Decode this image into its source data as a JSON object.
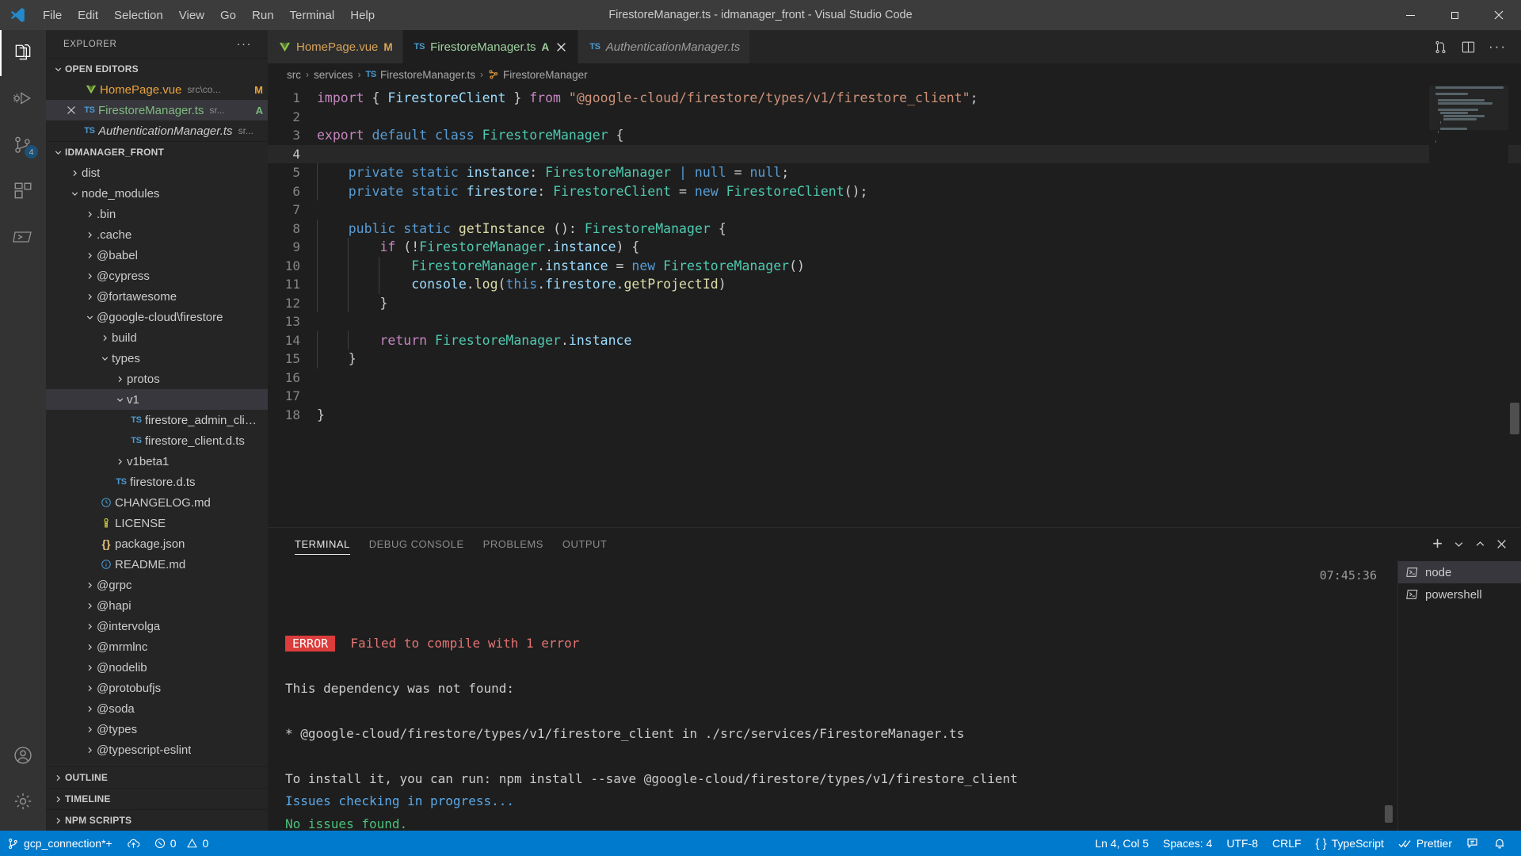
{
  "titlebar": {
    "title": "FirestoreManager.ts - idmanager_front - Visual Studio Code",
    "menus": [
      "File",
      "Edit",
      "Selection",
      "View",
      "Go",
      "Run",
      "Terminal",
      "Help"
    ],
    "minimize_label": "Minimize",
    "maximize_label": "Restore",
    "close_label": "Close"
  },
  "activitybar": {
    "items": [
      {
        "name": "explorer",
        "icon": "files-icon",
        "badge": ""
      },
      {
        "name": "run-and-debug",
        "icon": "debug-icon",
        "badge": ""
      },
      {
        "name": "source-control",
        "icon": "source-control-icon",
        "badge": "4"
      },
      {
        "name": "extensions",
        "icon": "extensions-icon",
        "badge": ""
      },
      {
        "name": "remote-explorer",
        "icon": "remote-icon",
        "badge": ""
      }
    ],
    "bottom": [
      {
        "name": "accounts",
        "icon": "account-icon"
      },
      {
        "name": "manage",
        "icon": "gear-icon"
      }
    ]
  },
  "sidebar": {
    "header": "EXPLORER",
    "more_actions": "···",
    "open_editors": {
      "title": "OPEN EDITORS",
      "items": [
        {
          "name": "HomePage.vue",
          "path": "src\\co...",
          "badge": "M",
          "icon": "vue-icon",
          "selected": false,
          "italic": false,
          "close": false
        },
        {
          "name": "FirestoreManager.ts",
          "path": "sr...",
          "badge": "A",
          "icon": "ts-icon",
          "selected": true,
          "italic": false,
          "close": true
        },
        {
          "name": "AuthenticationManager.ts",
          "path": "sr...",
          "badge": "",
          "icon": "ts-icon",
          "selected": false,
          "italic": true,
          "close": false
        }
      ]
    },
    "project": {
      "title": "IDMANAGER_FRONT",
      "tree": [
        {
          "label": "dist",
          "depth": 1,
          "kind": "folder",
          "state": "collapsed"
        },
        {
          "label": "node_modules",
          "depth": 1,
          "kind": "folder",
          "state": "expanded"
        },
        {
          "label": ".bin",
          "depth": 2,
          "kind": "folder",
          "state": "collapsed"
        },
        {
          "label": ".cache",
          "depth": 2,
          "kind": "folder",
          "state": "collapsed"
        },
        {
          "label": "@babel",
          "depth": 2,
          "kind": "folder",
          "state": "collapsed"
        },
        {
          "label": "@cypress",
          "depth": 2,
          "kind": "folder",
          "state": "collapsed"
        },
        {
          "label": "@fortawesome",
          "depth": 2,
          "kind": "folder",
          "state": "collapsed"
        },
        {
          "label": "@google-cloud\\firestore",
          "depth": 2,
          "kind": "folder",
          "state": "expanded"
        },
        {
          "label": "build",
          "depth": 3,
          "kind": "folder",
          "state": "collapsed"
        },
        {
          "label": "types",
          "depth": 3,
          "kind": "folder",
          "state": "expanded"
        },
        {
          "label": "protos",
          "depth": 4,
          "kind": "folder",
          "state": "collapsed"
        },
        {
          "label": "v1",
          "depth": 4,
          "kind": "folder",
          "state": "expanded",
          "selected": true
        },
        {
          "label": "firestore_admin_client.d.ts",
          "depth": 5,
          "kind": "file",
          "icon": "ts-icon"
        },
        {
          "label": "firestore_client.d.ts",
          "depth": 5,
          "kind": "file",
          "icon": "ts-icon"
        },
        {
          "label": "v1beta1",
          "depth": 4,
          "kind": "folder",
          "state": "collapsed"
        },
        {
          "label": "firestore.d.ts",
          "depth": 4,
          "kind": "file",
          "icon": "ts-icon"
        },
        {
          "label": "CHANGELOG.md",
          "depth": 3,
          "kind": "file",
          "icon": "changelog-icon"
        },
        {
          "label": "LICENSE",
          "depth": 3,
          "kind": "file",
          "icon": "license-icon"
        },
        {
          "label": "package.json",
          "depth": 3,
          "kind": "file",
          "icon": "json-icon"
        },
        {
          "label": "README.md",
          "depth": 3,
          "kind": "file",
          "icon": "readme-icon"
        },
        {
          "label": "@grpc",
          "depth": 2,
          "kind": "folder",
          "state": "collapsed"
        },
        {
          "label": "@hapi",
          "depth": 2,
          "kind": "folder",
          "state": "collapsed"
        },
        {
          "label": "@intervolga",
          "depth": 2,
          "kind": "folder",
          "state": "collapsed"
        },
        {
          "label": "@mrmlnc",
          "depth": 2,
          "kind": "folder",
          "state": "collapsed"
        },
        {
          "label": "@nodelib",
          "depth": 2,
          "kind": "folder",
          "state": "collapsed"
        },
        {
          "label": "@protobufjs",
          "depth": 2,
          "kind": "folder",
          "state": "collapsed"
        },
        {
          "label": "@soda",
          "depth": 2,
          "kind": "folder",
          "state": "collapsed"
        },
        {
          "label": "@types",
          "depth": 2,
          "kind": "folder",
          "state": "collapsed"
        },
        {
          "label": "@typescript-eslint",
          "depth": 2,
          "kind": "folder",
          "state": "collapsed"
        }
      ]
    },
    "bottom_sections": [
      "OUTLINE",
      "TIMELINE",
      "NPM SCRIPTS"
    ]
  },
  "editor": {
    "tabs": [
      {
        "label": "HomePage.vue",
        "icon": "vue-icon",
        "badge": "M",
        "active": false,
        "italic": false,
        "closable": false
      },
      {
        "label": "FirestoreManager.ts",
        "icon": "ts-icon",
        "badge": "A",
        "active": true,
        "italic": false,
        "closable": true
      },
      {
        "label": "AuthenticationManager.ts",
        "icon": "ts-icon",
        "badge": "",
        "active": false,
        "italic": true,
        "closable": false
      }
    ],
    "actions": [
      {
        "name": "split-diff-icon"
      },
      {
        "name": "split-editor-icon"
      },
      {
        "name": "more-actions-icon"
      }
    ],
    "breadcrumbs": [
      "src",
      "services",
      "FirestoreManager.ts",
      "FirestoreManager"
    ],
    "current_line": 4,
    "lines": [
      {
        "n": 1,
        "segs": [
          {
            "t": "import ",
            "c": "kw"
          },
          {
            "t": "{ ",
            "c": "pl"
          },
          {
            "t": "FirestoreClient",
            "c": "var"
          },
          {
            "t": " } ",
            "c": "pl"
          },
          {
            "t": "from ",
            "c": "kw"
          },
          {
            "t": "\"@google-cloud/firestore/types/v1/firestore_client\"",
            "c": "str"
          },
          {
            "t": ";",
            "c": "pl"
          }
        ]
      },
      {
        "n": 2,
        "segs": []
      },
      {
        "n": 3,
        "segs": [
          {
            "t": "export ",
            "c": "kw"
          },
          {
            "t": "default ",
            "c": "kw2"
          },
          {
            "t": "class ",
            "c": "kw2"
          },
          {
            "t": "FirestoreManager",
            "c": "typ"
          },
          {
            "t": " {",
            "c": "pl"
          }
        ]
      },
      {
        "n": 4,
        "segs": []
      },
      {
        "n": 5,
        "segs": [
          {
            "t": "    ",
            "c": "pl"
          },
          {
            "t": "private ",
            "c": "kw2"
          },
          {
            "t": "static ",
            "c": "kw2"
          },
          {
            "t": "instance",
            "c": "var"
          },
          {
            "t": ": ",
            "c": "pl"
          },
          {
            "t": "FirestoreManager",
            "c": "typ"
          },
          {
            "t": " | ",
            "c": "kw2"
          },
          {
            "t": "null",
            "c": "kw2"
          },
          {
            "t": " = ",
            "c": "pl"
          },
          {
            "t": "null",
            "c": "kw2"
          },
          {
            "t": ";",
            "c": "pl"
          }
        ]
      },
      {
        "n": 6,
        "segs": [
          {
            "t": "    ",
            "c": "pl"
          },
          {
            "t": "private ",
            "c": "kw2"
          },
          {
            "t": "static ",
            "c": "kw2"
          },
          {
            "t": "firestore",
            "c": "var"
          },
          {
            "t": ": ",
            "c": "pl"
          },
          {
            "t": "FirestoreClient",
            "c": "typ"
          },
          {
            "t": " = ",
            "c": "pl"
          },
          {
            "t": "new ",
            "c": "kw2"
          },
          {
            "t": "FirestoreClient",
            "c": "typ"
          },
          {
            "t": "();",
            "c": "pl"
          }
        ]
      },
      {
        "n": 7,
        "segs": []
      },
      {
        "n": 8,
        "segs": [
          {
            "t": "    ",
            "c": "pl"
          },
          {
            "t": "public ",
            "c": "kw2"
          },
          {
            "t": "static ",
            "c": "kw2"
          },
          {
            "t": "getInstance ",
            "c": "fn"
          },
          {
            "t": "(): ",
            "c": "pl"
          },
          {
            "t": "FirestoreManager",
            "c": "typ"
          },
          {
            "t": " {",
            "c": "pl"
          }
        ]
      },
      {
        "n": 9,
        "segs": [
          {
            "t": "        ",
            "c": "pl"
          },
          {
            "t": "if ",
            "c": "ctrl"
          },
          {
            "t": "(!",
            "c": "pl"
          },
          {
            "t": "FirestoreManager",
            "c": "typ"
          },
          {
            "t": ".",
            "c": "pl"
          },
          {
            "t": "instance",
            "c": "var"
          },
          {
            "t": ") {",
            "c": "pl"
          }
        ]
      },
      {
        "n": 10,
        "segs": [
          {
            "t": "            ",
            "c": "pl"
          },
          {
            "t": "FirestoreManager",
            "c": "typ"
          },
          {
            "t": ".",
            "c": "pl"
          },
          {
            "t": "instance",
            "c": "var"
          },
          {
            "t": " = ",
            "c": "pl"
          },
          {
            "t": "new ",
            "c": "kw2"
          },
          {
            "t": "FirestoreManager",
            "c": "typ"
          },
          {
            "t": "()",
            "c": "pl"
          }
        ]
      },
      {
        "n": 11,
        "segs": [
          {
            "t": "            ",
            "c": "pl"
          },
          {
            "t": "console",
            "c": "var"
          },
          {
            "t": ".",
            "c": "pl"
          },
          {
            "t": "log",
            "c": "fn"
          },
          {
            "t": "(",
            "c": "pl"
          },
          {
            "t": "this",
            "c": "kw2"
          },
          {
            "t": ".",
            "c": "pl"
          },
          {
            "t": "firestore",
            "c": "var"
          },
          {
            "t": ".",
            "c": "pl"
          },
          {
            "t": "getProjectId",
            "c": "fn"
          },
          {
            "t": ")",
            "c": "pl"
          }
        ]
      },
      {
        "n": 12,
        "segs": [
          {
            "t": "        }",
            "c": "pl"
          }
        ]
      },
      {
        "n": 13,
        "segs": []
      },
      {
        "n": 14,
        "segs": [
          {
            "t": "        ",
            "c": "pl"
          },
          {
            "t": "return ",
            "c": "kw"
          },
          {
            "t": "FirestoreManager",
            "c": "typ"
          },
          {
            "t": ".",
            "c": "pl"
          },
          {
            "t": "instance",
            "c": "var"
          }
        ]
      },
      {
        "n": 15,
        "segs": [
          {
            "t": "    }",
            "c": "pl"
          }
        ]
      },
      {
        "n": 16,
        "segs": []
      },
      {
        "n": 17,
        "segs": []
      },
      {
        "n": 18,
        "segs": [
          {
            "t": "}",
            "c": "pl"
          }
        ]
      }
    ]
  },
  "panel": {
    "tabs": [
      "TERMINAL",
      "DEBUG CONSOLE",
      "PROBLEMS",
      "OUTPUT"
    ],
    "active_tab": "TERMINAL",
    "actions": [
      {
        "name": "new-terminal-icon",
        "glyph": "+"
      },
      {
        "name": "terminal-dropdown-icon",
        "glyph": "˅"
      },
      {
        "name": "maximize-panel-icon",
        "glyph": "˄"
      },
      {
        "name": "close-panel-icon",
        "glyph": "✕"
      }
    ],
    "timestamp": "07:45:36",
    "terminal_lines": [
      {
        "type": "error_badge",
        "badge": "ERROR",
        "text": "Failed to compile with 1 error"
      },
      {
        "type": "blank",
        "text": ""
      },
      {
        "type": "plain",
        "text": "This dependency was not found:"
      },
      {
        "type": "blank",
        "text": ""
      },
      {
        "type": "plain",
        "text": "* @google-cloud/firestore/types/v1/firestore_client in ./src/services/FirestoreManager.ts"
      },
      {
        "type": "blank",
        "text": ""
      },
      {
        "type": "plain",
        "text": "To install it, you can run: npm install --save @google-cloud/firestore/types/v1/firestore_client"
      },
      {
        "type": "info",
        "text": "Issues checking in progress..."
      },
      {
        "type": "success",
        "text": "No issues found."
      },
      {
        "type": "cursor",
        "text": ""
      }
    ],
    "terminal_list": [
      {
        "label": "node",
        "icon": "terminal-icon",
        "selected": true
      },
      {
        "label": "powershell",
        "icon": "terminal-icon",
        "selected": false
      }
    ]
  },
  "statusbar": {
    "branch": "gcp_connection*+",
    "sync_icon": "sync-cloud-icon",
    "errors": "0",
    "warnings": "0",
    "cursor_position": "Ln 4, Col 5",
    "indentation": "Spaces: 4",
    "encoding": "UTF-8",
    "eol": "CRLF",
    "language": "TypeScript",
    "formatter": "Prettier",
    "feedback_icon": "feedback-icon",
    "bell_icon": "bell-icon"
  },
  "colors": {
    "accent": "#007acc",
    "error": "#dc3c3c",
    "panel_bg": "#1e1e1e",
    "sidebar_bg": "#252526",
    "activity_bg": "#333333"
  }
}
